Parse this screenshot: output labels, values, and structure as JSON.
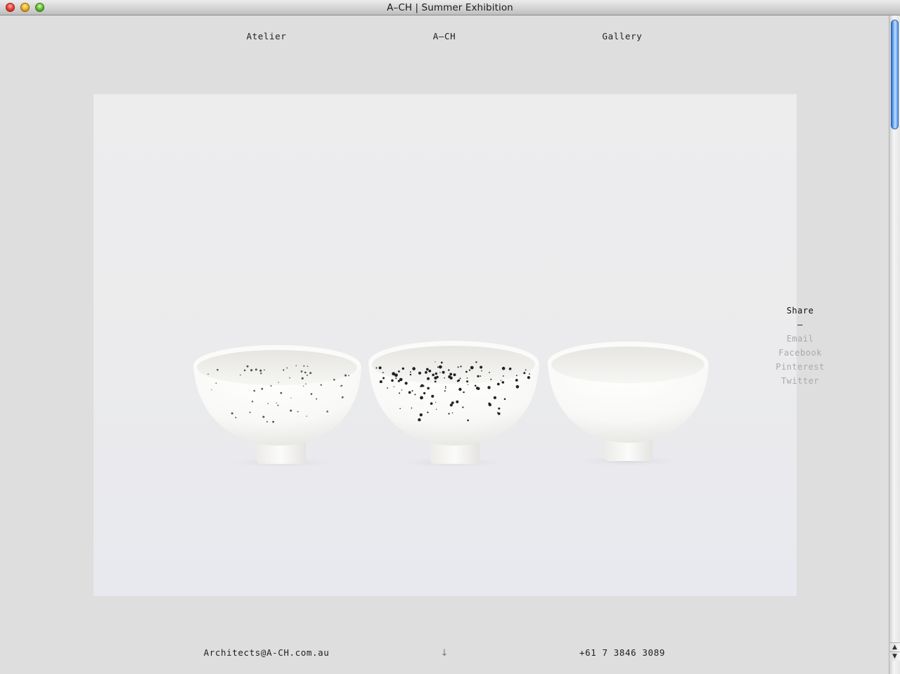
{
  "window": {
    "title": "A–CH | Summer Exhibition"
  },
  "nav": {
    "items": [
      {
        "label": "Atelier"
      },
      {
        "label": "A–CH"
      },
      {
        "label": "Gallery"
      }
    ]
  },
  "share": {
    "title": "Share",
    "separator": "–",
    "links": [
      {
        "label": "Email"
      },
      {
        "label": "Facebook"
      },
      {
        "label": "Pinterest"
      },
      {
        "label": "Twitter"
      }
    ]
  },
  "footer": {
    "email": "Architects@A-CH.com.au",
    "scroll_icon": "down-arrow-icon",
    "phone": "+61 7 3846 3089"
  },
  "scrollbar": {
    "up_icon": "scroll-up-arrow-icon",
    "down_icon": "scroll-down-arrow-icon"
  },
  "colors": {
    "page_background": "#dedede",
    "photo_background": "#ebebed",
    "share_link": "#a9a9a9",
    "text": "#1e1e1e"
  }
}
